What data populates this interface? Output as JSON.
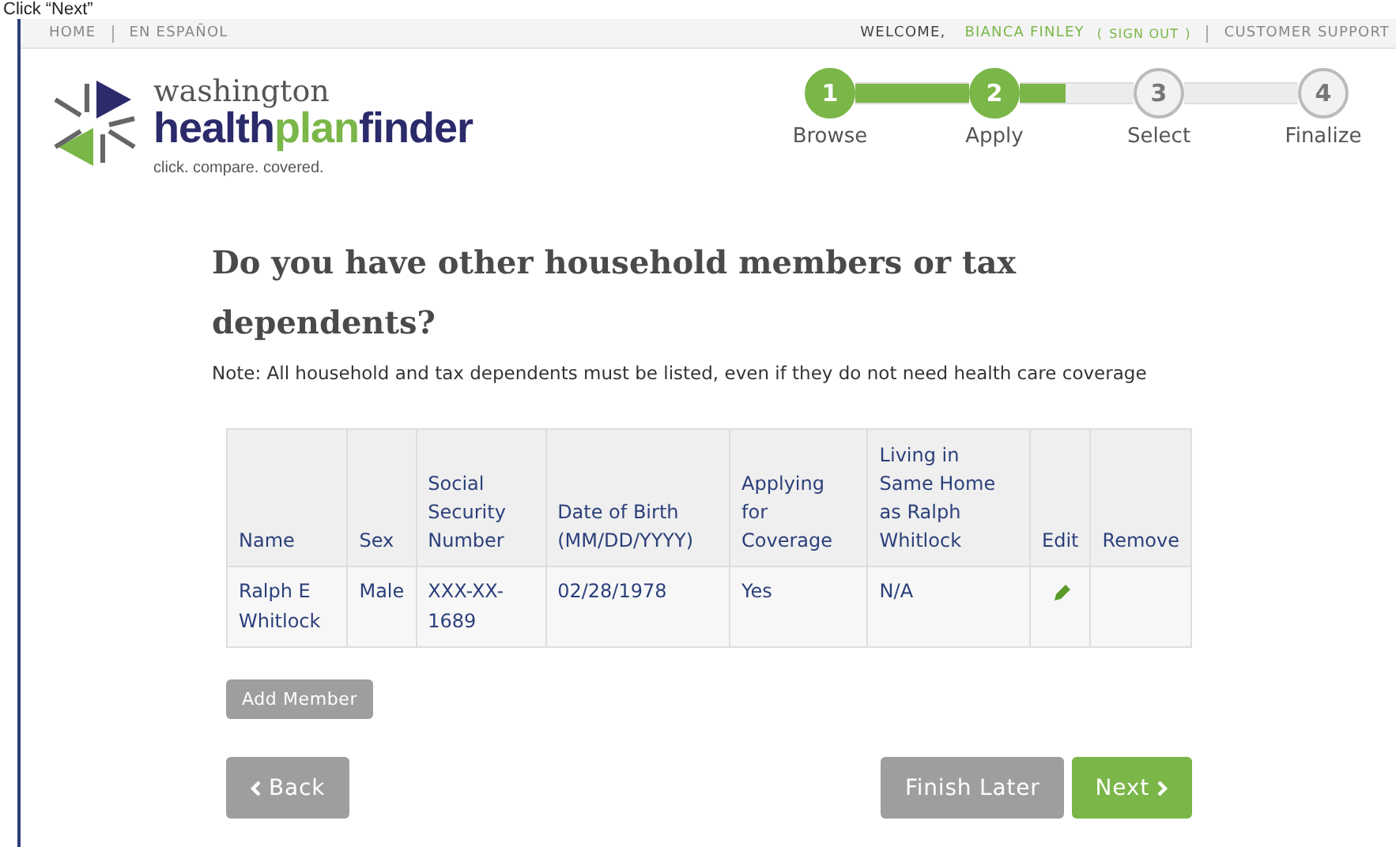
{
  "caption": "Click “Next”",
  "top_bar": {
    "links": [
      "HOME",
      "EN ESPAÑOL"
    ],
    "welcome": "WELCOME,",
    "user": "BIANCA FINLEY",
    "sign_out_open": "(",
    "sign_out": "SIGN OUT",
    "sign_out_close": ")",
    "support": "CUSTOMER SUPPORT"
  },
  "logo": {
    "line1": "washington",
    "health": "health",
    "plan": "plan",
    "finder": "finder",
    "tagline": "click. compare. covered."
  },
  "stepper": {
    "connectors": [
      {
        "level": 1
      },
      {
        "level": 0.4
      }
    ],
    "steps": [
      {
        "number": "1",
        "label": "Browse",
        "reached": true
      },
      {
        "number": "2",
        "label": "Apply",
        "reached": true
      },
      {
        "number": "3",
        "label": "Select",
        "reached": false
      },
      {
        "number": "4",
        "label": "Finalize",
        "reached": false
      }
    ]
  },
  "heading": "Do you have other household members or tax dependents?",
  "note": "Note: All household and tax dependents must be listed, even if they do not need health care coverage",
  "table": {
    "columns": [
      "Name",
      "Sex",
      "Social Security Number",
      "Date of Birth (MM/DD/YYYY)",
      "Applying for Coverage",
      "Living in Same Home as Ralph Whitlock",
      "Edit",
      "Remove"
    ],
    "rows": [
      {
        "cells": [
          "Ralph E Whitlock",
          "Male",
          "XXX-XX-1689",
          "02/28/1978",
          "Yes",
          "N/A"
        ],
        "editable": true
      }
    ]
  },
  "add_button": "Add Member",
  "back_button": "Back",
  "finish_button": "Finish Later",
  "next_button": "Next"
}
